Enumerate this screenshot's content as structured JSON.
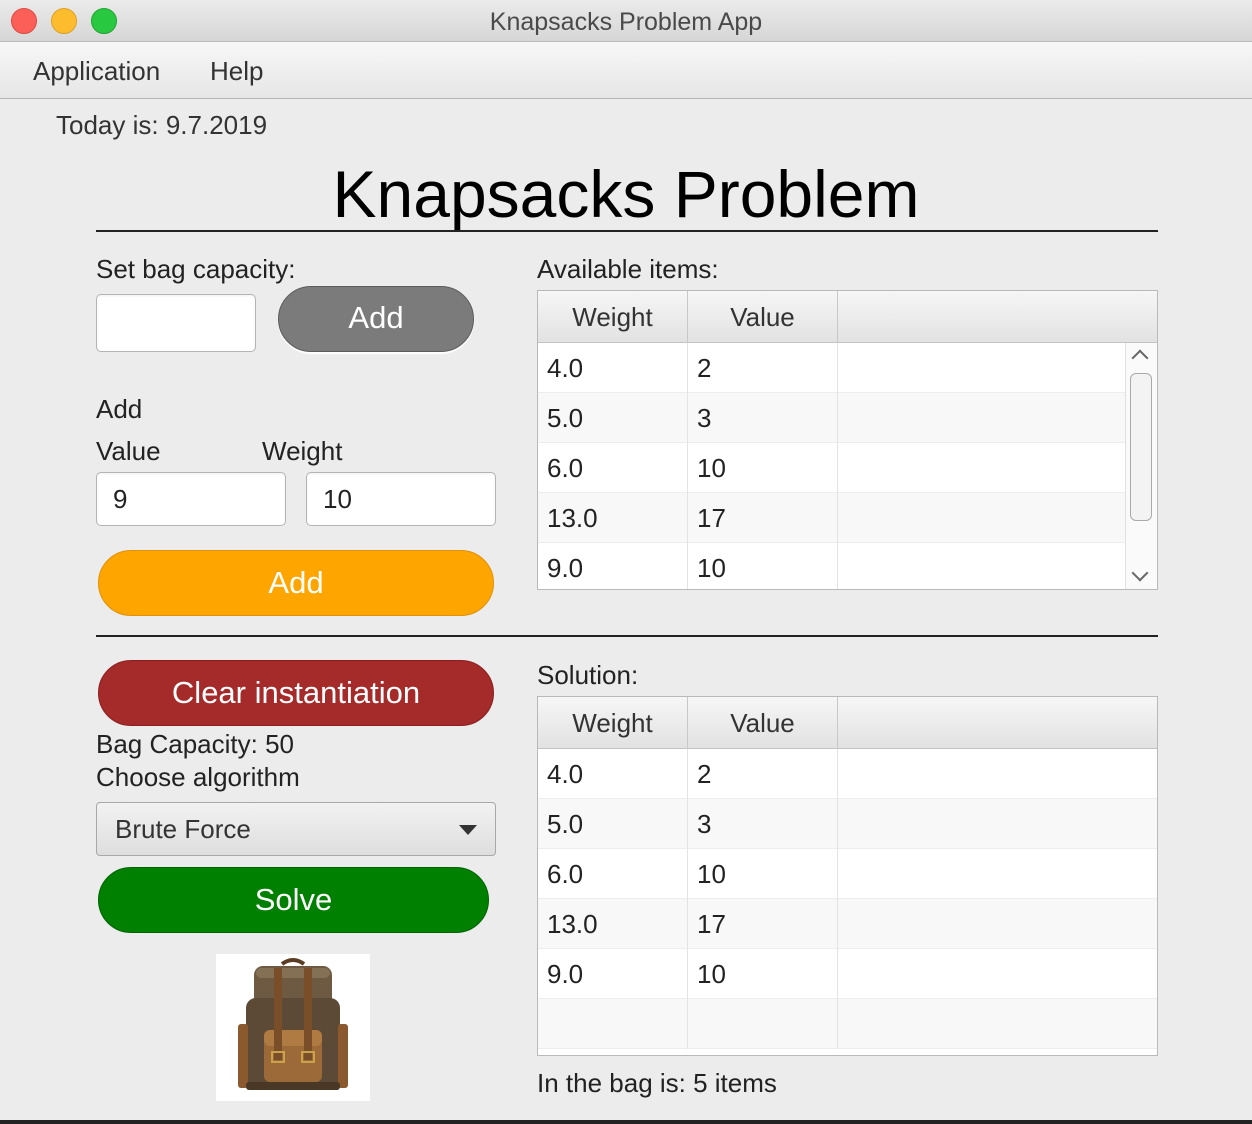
{
  "window": {
    "title": "Knapsacks Problem App"
  },
  "menu": {
    "application": "Application",
    "help": "Help"
  },
  "today": "Today is: 9.7.2019",
  "main_title": "Knapsacks Problem",
  "capacity": {
    "label": "Set bag capacity:",
    "value": "",
    "button": "Add"
  },
  "add_item": {
    "heading": "Add",
    "value_label": "Value",
    "weight_label": "Weight",
    "value": "9",
    "weight": "10",
    "button": "Add"
  },
  "clear_button": "Clear instantiation",
  "bag_capacity": "Bag Capacity: 50",
  "algorithm": {
    "label": "Choose algorithm",
    "selected": "Brute Force"
  },
  "solve_button": "Solve",
  "available": {
    "label": "Available items:",
    "columns": [
      "Weight",
      "Value"
    ],
    "rows": [
      [
        "4.0",
        "2"
      ],
      [
        "5.0",
        "3"
      ],
      [
        "6.0",
        "10"
      ],
      [
        "13.0",
        "17"
      ],
      [
        "9.0",
        "10"
      ]
    ]
  },
  "solution": {
    "label": "Solution:",
    "columns": [
      "Weight",
      "Value"
    ],
    "rows": [
      [
        "4.0",
        "2"
      ],
      [
        "5.0",
        "3"
      ],
      [
        "6.0",
        "10"
      ],
      [
        "13.0",
        "17"
      ],
      [
        "9.0",
        "10"
      ]
    ],
    "summary": "In the bag is: 5 items"
  },
  "colors": {
    "add_button": "#ffa500",
    "clear_button": "#a52a2a",
    "solve_button": "#008000",
    "capacity_button": "#7b7b7b"
  }
}
